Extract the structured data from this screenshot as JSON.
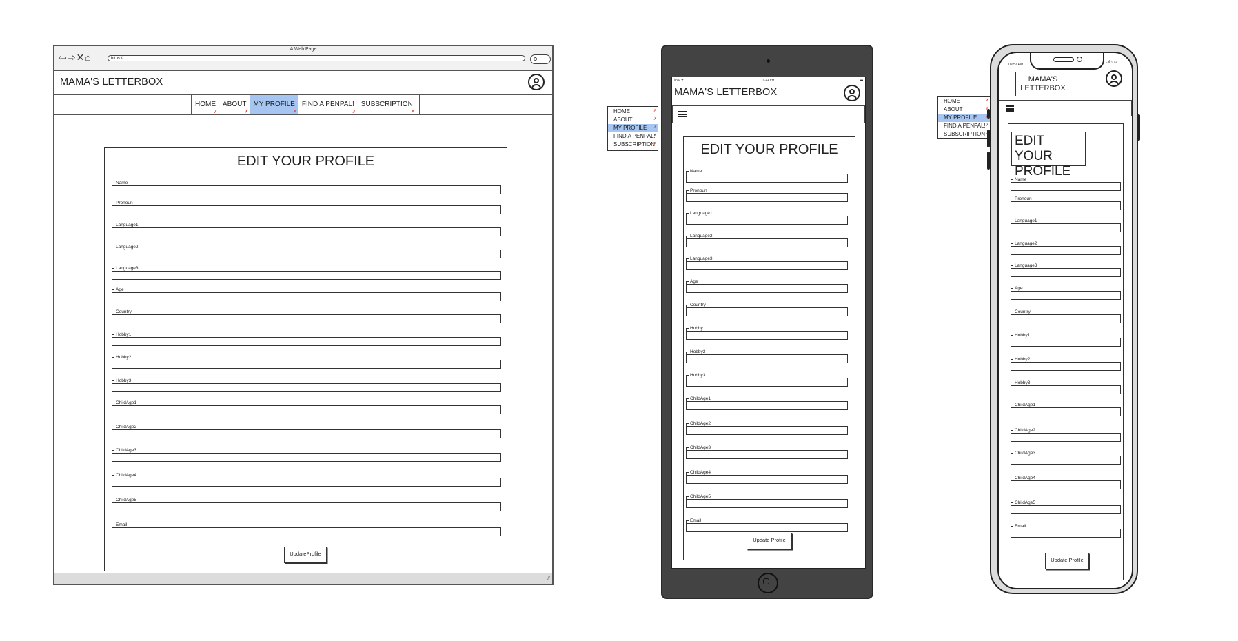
{
  "brand": "MAMA'S LETTERBOX",
  "nav": [
    {
      "label": "HOME",
      "active": false
    },
    {
      "label": "ABOUT",
      "active": false
    },
    {
      "label": "MY PROFILE",
      "active": true
    },
    {
      "label": "FIND A PENPAL!",
      "active": false
    },
    {
      "label": "SUBSCRIPTION",
      "active": false
    }
  ],
  "desktop": {
    "window_title": "A Web Page",
    "url": "https://",
    "nav_buttons": "⇦⇨✕⌂",
    "form_title": "EDIT YOUR PROFILE",
    "button_label": "UpdateProfile"
  },
  "ipad": {
    "status_left": "iPad ✈",
    "status_center": "4:21 PM",
    "status_right": "▬",
    "form_title": "EDIT YOUR PROFILE",
    "button_label": "Update Profile",
    "menu_items": [
      "HOME",
      "ABOUT",
      "MY PROFILE",
      "FIND A PENPAL!",
      "SUBSCRIPTION"
    ],
    "active_item": 2
  },
  "iphone": {
    "time": "09:52 AM",
    "status_icons": "..ıl ≈ ▭",
    "brand_line1": "MAMA'S",
    "brand_line2": "LETTERBOX",
    "form_title_line1": "EDIT YOUR",
    "form_title_line2": "PROFILE",
    "button_label": "Update Profile",
    "menu_items": [
      "HOME",
      "ABOUT",
      "MY PROFILE",
      "FIND A PENPAL!",
      "SUBSCRIPTION"
    ],
    "active_item": 2
  },
  "fields": [
    "Name",
    "Pronoun",
    "Language1",
    "Language2",
    "Language3",
    "Age",
    "Country",
    "Hobby1",
    "Hobby2",
    "Hobby3",
    "ChildAge1",
    "ChildAge2",
    "ChildAge3",
    "ChildAge4",
    "ChildAge5",
    "Email"
  ]
}
